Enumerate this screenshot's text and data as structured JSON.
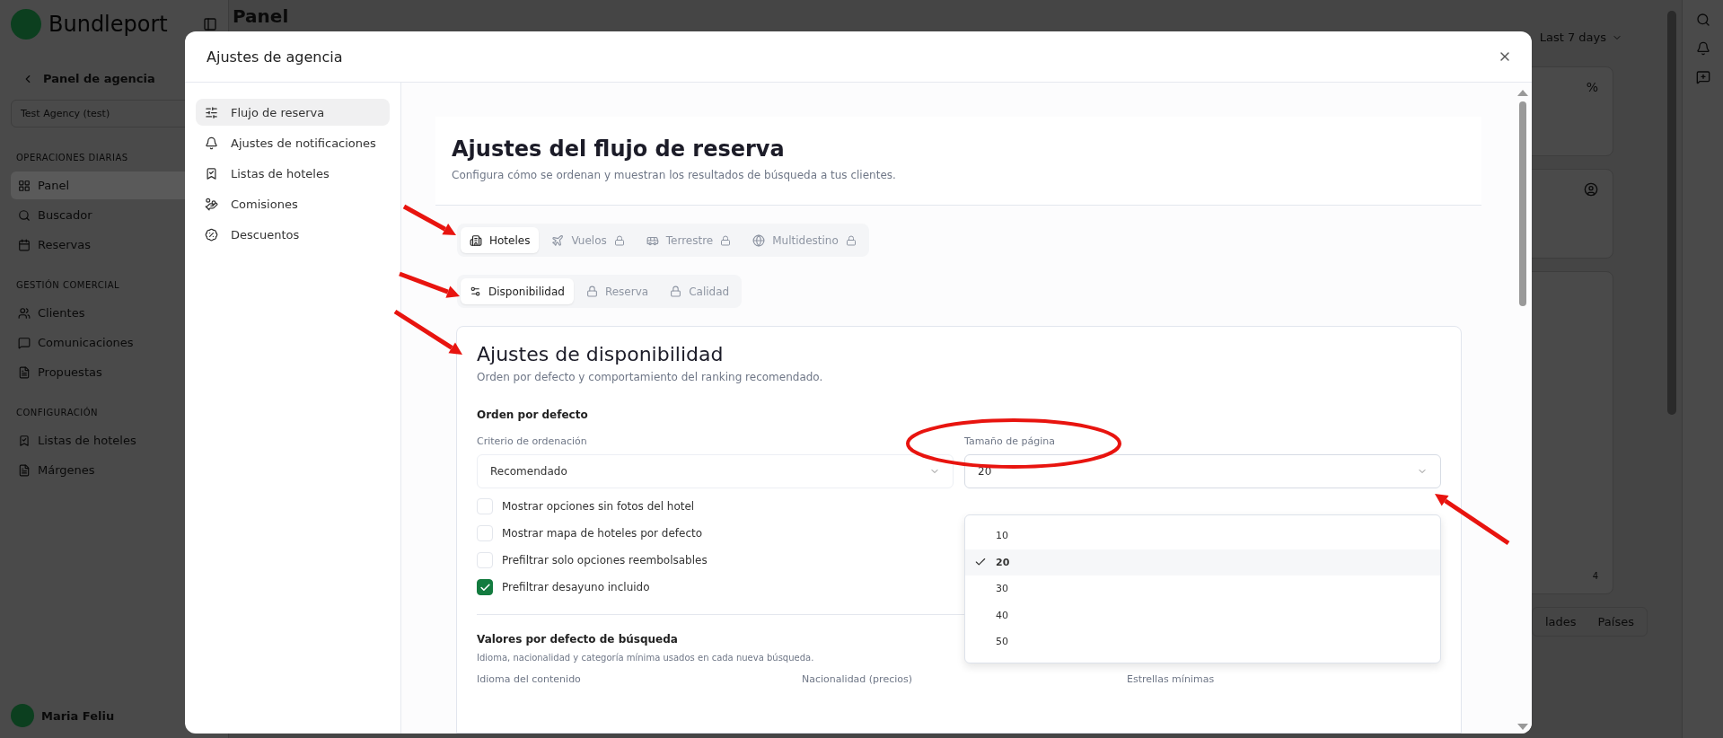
{
  "app": {
    "logo": "Bundleport",
    "back": "Panel de agencia",
    "agency": "Test Agency (test)",
    "sections": [
      {
        "title": "OPERACIONES DIARIAS",
        "items": [
          {
            "label": "Panel",
            "selected": true
          },
          {
            "label": "Buscador",
            "selected": false
          },
          {
            "label": "Reservas",
            "selected": false
          }
        ]
      },
      {
        "title": "GESTIÓN COMERCIAL",
        "items": [
          {
            "label": "Clientes",
            "selected": false
          },
          {
            "label": "Comunicaciones",
            "selected": false
          },
          {
            "label": "Propuestas",
            "selected": false
          }
        ]
      },
      {
        "title": "CONFIGURACIÓN",
        "items": [
          {
            "label": "Listas de hoteles",
            "selected": false
          },
          {
            "label": "Márgenes",
            "selected": false
          }
        ]
      }
    ],
    "user": "Maria Feliu",
    "page_title": "Panel",
    "period": "Last 7 days",
    "card_symbol": "%",
    "axis_tick": "4",
    "tabs": [
      "lades",
      "Países"
    ]
  },
  "modal": {
    "title": "Ajustes de agencia",
    "nav": [
      {
        "label": "Flujo de reserva",
        "selected": true
      },
      {
        "label": "Ajustes de notificaciones",
        "selected": false
      },
      {
        "label": "Listas de hoteles",
        "selected": false
      },
      {
        "label": "Comisiones",
        "selected": false
      },
      {
        "label": "Descuentos",
        "selected": false
      }
    ],
    "header": {
      "title": "Ajustes del flujo de reserva",
      "subtitle": "Configura cómo se ordenan y muestran los resultados de búsqueda a tus clientes."
    },
    "tabs": [
      {
        "label": "Hoteles",
        "selected": true,
        "locked": false
      },
      {
        "label": "Vuelos",
        "selected": false,
        "locked": true
      },
      {
        "label": "Terrestre",
        "selected": false,
        "locked": true
      },
      {
        "label": "Multidestino",
        "selected": false,
        "locked": true
      }
    ],
    "subtabs": [
      {
        "label": "Disponibilidad",
        "selected": true,
        "locked": false
      },
      {
        "label": "Reserva",
        "selected": false,
        "locked": true
      },
      {
        "label": "Calidad",
        "selected": false,
        "locked": true
      }
    ],
    "card": {
      "title": "Ajustes de disponibilidad",
      "subtitle": "Orden por defecto y comportamiento del ranking recomendado.",
      "section1": "Orden por defecto",
      "fields": [
        {
          "label": "Criterio de ordenación",
          "value": "Recomendado",
          "expanded": false
        },
        {
          "label": "Tamaño de página",
          "value": "20",
          "expanded": true
        }
      ],
      "options": [
        {
          "label": "10",
          "selected": false
        },
        {
          "label": "20",
          "selected": true
        },
        {
          "label": "30",
          "selected": false
        },
        {
          "label": "40",
          "selected": false
        },
        {
          "label": "50",
          "selected": false
        }
      ],
      "checkboxes": [
        {
          "label": "Mostrar opciones sin fotos del hotel",
          "checked": false
        },
        {
          "label": "Mostrar mapa de hoteles por defecto",
          "checked": false
        },
        {
          "label": "Prefiltrar solo opciones reembolsables",
          "checked": false
        },
        {
          "label": "Prefiltrar desayuno incluido",
          "checked": true
        }
      ],
      "section2": "Valores por defecto de búsqueda",
      "section2_desc": "Idioma, nacionalidad y categoría mínima usados en cada nueva búsqueda.",
      "labels2": [
        "Idioma del contenido",
        "Nacionalidad (precios)",
        "Estrellas mínimas"
      ]
    }
  }
}
